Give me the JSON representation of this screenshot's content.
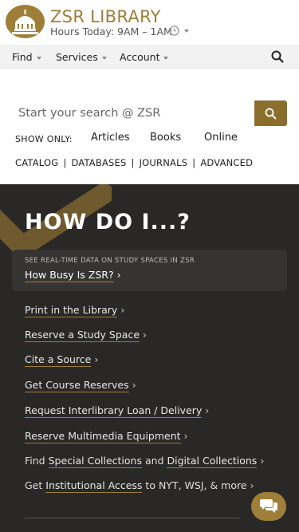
{
  "header": {
    "title": "ZSR LIBRARY",
    "hours": "Hours Today: 9AM – 1AM"
  },
  "nav": {
    "items": [
      "Find",
      "Services",
      "Account"
    ]
  },
  "search": {
    "placeholder": "Start your search @ ZSR",
    "show_only_label": "SHOW ONLY:",
    "filters": [
      "Articles",
      "Books",
      "Online"
    ],
    "scopes": [
      "CATALOG",
      "DATABASES",
      "JOURNALS",
      "ADVANCED"
    ],
    "separator": "|"
  },
  "panel": {
    "title": "HOW DO I...?",
    "busy_eyebrow": "SEE REAL-TIME DATA ON STUDY SPACES IN ZSR",
    "busy_link": "How Busy Is ZSR?",
    "arrow": "›",
    "links": [
      "Print in the Library",
      "Reserve a Study Space",
      "Cite a Source",
      "Get Course Reserves",
      "Request Interlibrary Loan / Delivery",
      "Reserve Multimedia Equipment"
    ],
    "find_row": {
      "prefix": "Find",
      "link1": "Special Collections",
      "middle": "and",
      "link2": "Digital Collections"
    },
    "access_row": {
      "prefix": "Get",
      "link": "Institutional Access",
      "suffix": "to NYT, WSJ, & more"
    }
  },
  "colors": {
    "brand_gold": "#9e7e38",
    "search_button": "#8a6f2c",
    "panel_bg": "#2a2826"
  },
  "icons": [
    "library-logo-icon",
    "clock-icon",
    "search-icon",
    "chat-icon"
  ]
}
